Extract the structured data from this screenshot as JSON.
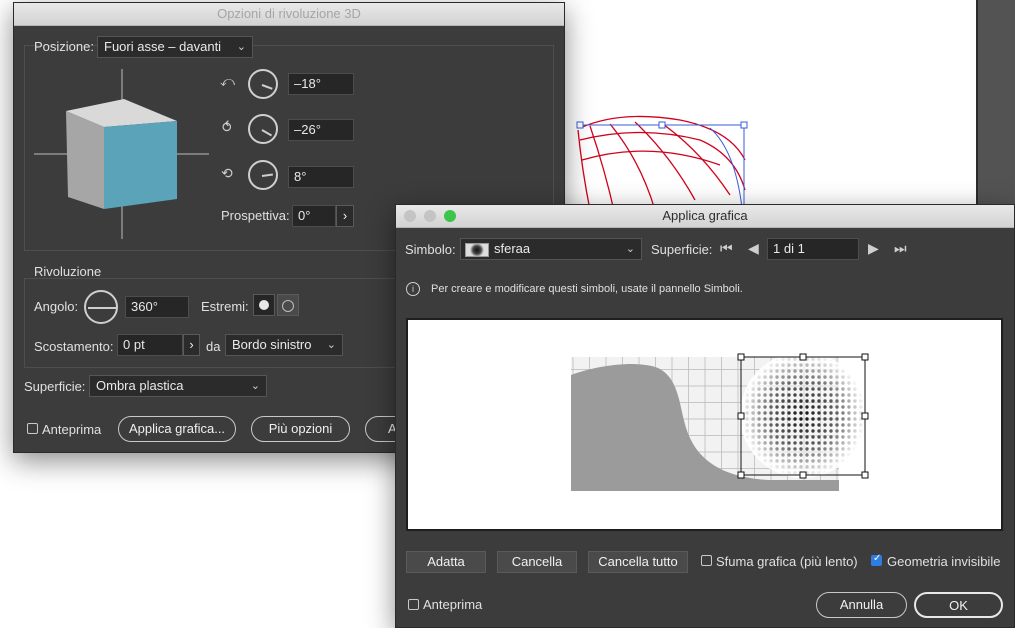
{
  "revolve_dialog": {
    "title": "Opzioni di rivoluzione 3D",
    "position_label": "Posizione:",
    "position_value": "Fuori asse – davanti",
    "rot_x": "–18°",
    "rot_y": "–26°",
    "rot_z": "8°",
    "perspective_label": "Prospettiva:",
    "perspective_value": "0°",
    "revolve_section": "Rivoluzione",
    "angle_label": "Angolo:",
    "angle_value": "360°",
    "caps_label": "Estremi:",
    "offset_label": "Scostamento:",
    "offset_value": "0 pt",
    "from_label": "da",
    "from_value": "Bordo sinistro",
    "surface_label": "Superficie:",
    "surface_value": "Ombra plastica",
    "preview_label": "Anteprima",
    "map_art_button": "Applica grafica...",
    "more_options_button": "Più opzioni",
    "ok_partial": "A"
  },
  "map_art_dialog": {
    "title": "Applica grafica",
    "symbol_label": "Simbolo:",
    "symbol_value": "sferaa",
    "surface_label": "Superficie:",
    "surface_value": "1 di 1",
    "info_text": "Per creare e modificare questi simboli, usate il pannello Simboli.",
    "fit_button": "Adatta",
    "clear_button": "Cancella",
    "clear_all_button": "Cancella tutto",
    "shade_label": "Sfuma grafica (più lento)",
    "invisible_label": "Geometria invisibile",
    "preview_label": "Anteprima",
    "cancel_button": "Annulla",
    "ok_button": "OK"
  },
  "colors": {
    "cube_front": "#5ba3b8",
    "wireframe": "#d0021b",
    "checkbox_blue": "#2f7de1"
  }
}
